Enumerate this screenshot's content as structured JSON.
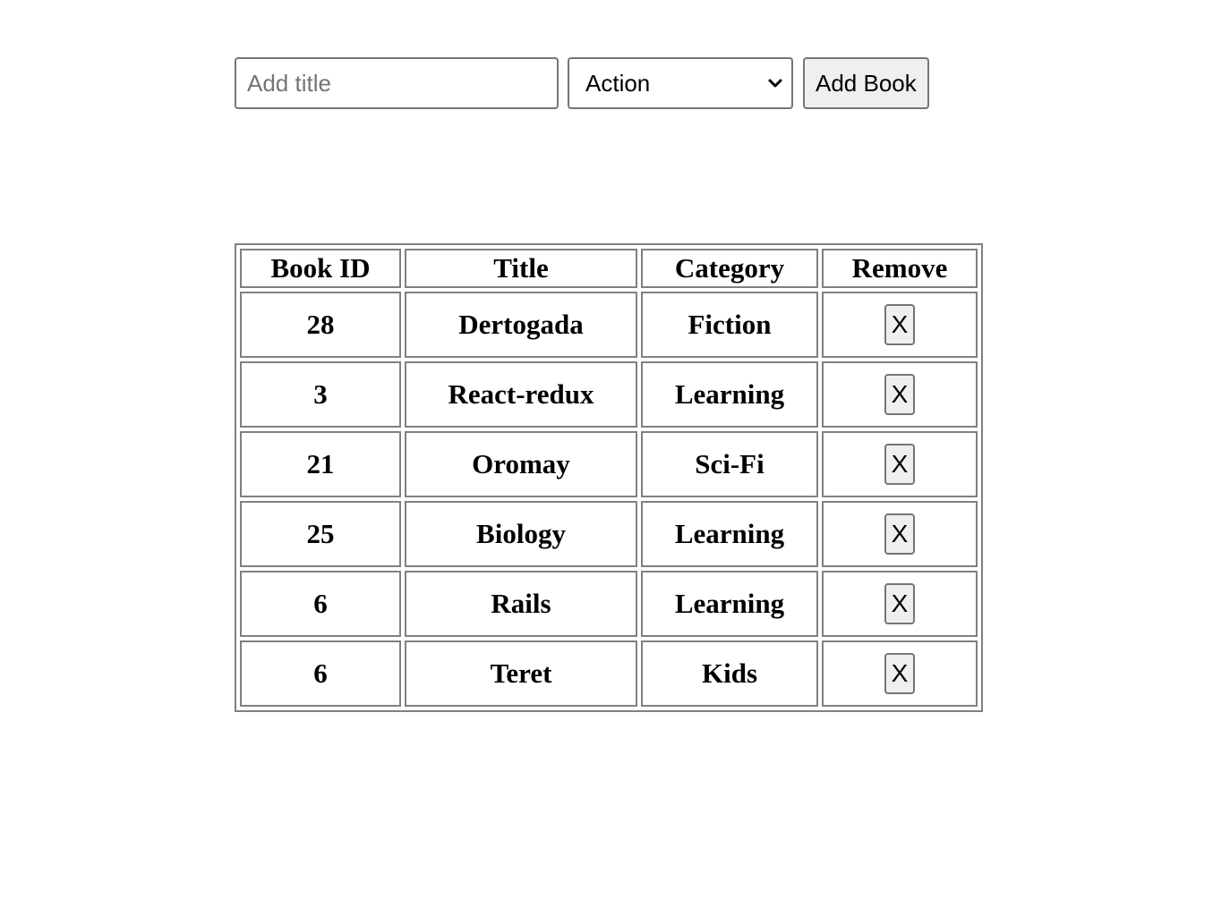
{
  "form": {
    "title_placeholder": "Add title",
    "title_value": "",
    "category_selected": "Action",
    "add_button_label": "Add Book"
  },
  "table": {
    "headers": [
      "Book ID",
      "Title",
      "Category",
      "Remove"
    ],
    "rows": [
      {
        "id": "28",
        "title": "Dertogada",
        "category": "Fiction",
        "remove_label": "X"
      },
      {
        "id": "3",
        "title": "React-redux",
        "category": "Learning",
        "remove_label": "X"
      },
      {
        "id": "21",
        "title": "Oromay",
        "category": "Sci-Fi",
        "remove_label": "X"
      },
      {
        "id": "25",
        "title": "Biology",
        "category": "Learning",
        "remove_label": "X"
      },
      {
        "id": "6",
        "title": "Rails",
        "category": "Learning",
        "remove_label": "X"
      },
      {
        "id": "6",
        "title": "Teret",
        "category": "Kids",
        "remove_label": "X"
      }
    ]
  },
  "icons": {
    "select_arrow": "chevron-down-icon"
  }
}
